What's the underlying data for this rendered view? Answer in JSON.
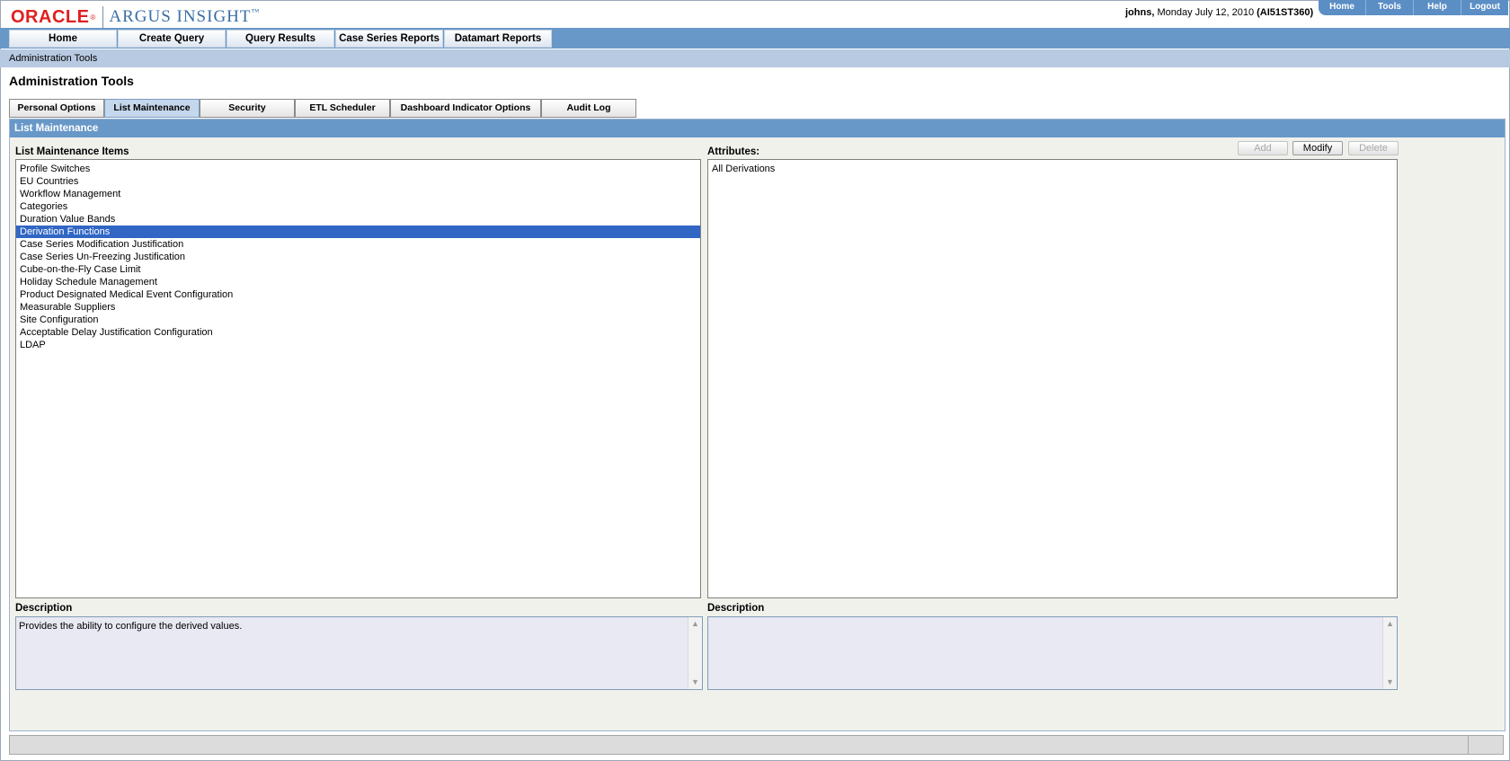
{
  "brand": {
    "oracle": "ORACLE",
    "oracle_mark": "®",
    "product": "ARGUS INSIGHT",
    "product_mark": "™"
  },
  "user": {
    "name": "johns,",
    "date": " Monday July 12, 2010 ",
    "server": "(AI51ST360)"
  },
  "top_links": [
    "Home",
    "Tools",
    "Help",
    "Logout"
  ],
  "main_nav": [
    "Home",
    "Create Query",
    "Query Results",
    "Case Series Reports",
    "Datamart Reports"
  ],
  "breadcrumb": "Administration Tools",
  "page_title": "Administration Tools",
  "tabs": [
    "Personal Options",
    "List Maintenance",
    "Security",
    "ETL Scheduler",
    "Dashboard Indicator Options",
    "Audit Log"
  ],
  "active_tab": "List Maintenance",
  "section_title": "List Maintenance",
  "left_panel": {
    "label": "List Maintenance Items",
    "items": [
      "Profile Switches",
      "EU Countries",
      "Workflow Management",
      "Categories",
      "Duration Value Bands",
      "Derivation Functions",
      "Case Series Modification Justification",
      "Case Series Un-Freezing Justification",
      "Cube-on-the-Fly Case Limit",
      "Holiday Schedule Management",
      "Product Designated Medical Event Configuration",
      "Measurable Suppliers",
      "Site Configuration",
      "Acceptable Delay Justification Configuration",
      "LDAP"
    ],
    "selected_item": "Derivation Functions",
    "description_label": "Description",
    "description_text": "Provides the ability to configure the derived values."
  },
  "right_panel": {
    "label": "Attributes:",
    "buttons": {
      "add": "Add",
      "modify": "Modify",
      "delete": "Delete"
    },
    "items": [
      "All Derivations"
    ],
    "description_label": "Description",
    "description_text": ""
  },
  "icons": {
    "scroll_up": "scroll-up-arrow-icon",
    "scroll_down": "scroll-down-arrow-icon"
  },
  "colors": {
    "nav_blue": "#6898c8",
    "selection": "#3166c4",
    "oracle_red": "#e02020"
  }
}
